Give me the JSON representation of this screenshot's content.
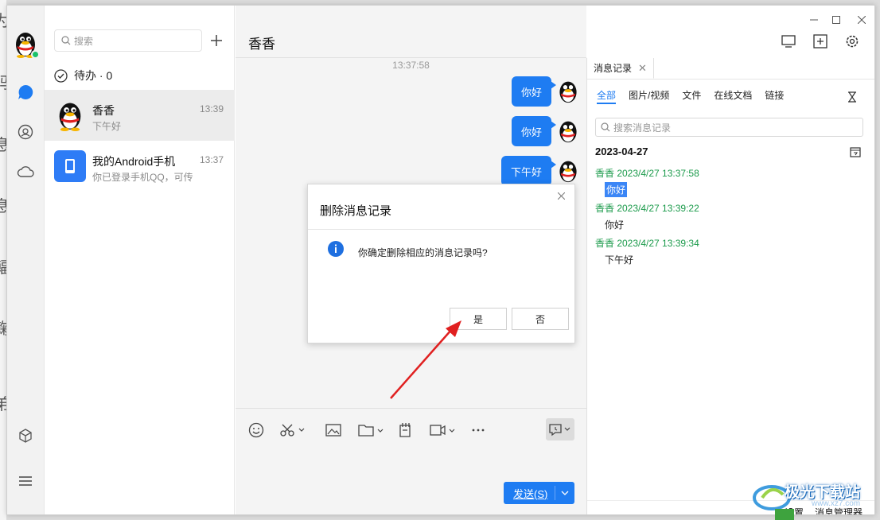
{
  "background": {
    "glyphs": [
      "为",
      "码",
      "息",
      "息",
      "輻",
      "鞠",
      "弟"
    ]
  },
  "rail": {
    "icons": [
      "avatar",
      "chat-bubble-icon",
      "contacts-icon",
      "cloud-icon",
      "apps-cube-icon",
      "menu-icon"
    ]
  },
  "contacts": {
    "search_placeholder": "搜索",
    "todo_label": "待办 · 0",
    "items": [
      {
        "name": "香香",
        "time": "13:39",
        "preview": "下午好",
        "selected": true
      },
      {
        "name": "我的Android手机",
        "time": "13:37",
        "preview": "你已登录手机QQ，可传"
      }
    ]
  },
  "chat": {
    "title": "香香",
    "timestamp": "13:37:58",
    "messages": [
      "你好",
      "你好",
      "下午好"
    ],
    "send_label": "发送(S)"
  },
  "history": {
    "tab_label": "消息记录",
    "filters": [
      "全部",
      "图片/视频",
      "文件",
      "在线文档",
      "链接"
    ],
    "search_placeholder": "搜索消息记录",
    "date": "2023-04-27",
    "entries": [
      {
        "sender": "香香 2023/4/27 13:37:58",
        "text": "你好",
        "highlighted": true
      },
      {
        "sender": "香香 2023/4/27 13:39:22",
        "text": "你好"
      },
      {
        "sender": "香香 2023/4/27 13:39:34",
        "text": "下午好"
      }
    ],
    "footer_settings": "设置",
    "footer_manager": "消息管理器"
  },
  "dialog": {
    "title": "删除消息记录",
    "message": "你确定删除相应的消息记录吗?",
    "confirm": "是",
    "cancel": "否"
  },
  "watermark": {
    "text": "极光下载站",
    "url": "www.xz7.com"
  },
  "colors": {
    "accent": "#1e7cf2",
    "sender_green": "#1a9a4a",
    "annotation_red": "#e02020"
  }
}
